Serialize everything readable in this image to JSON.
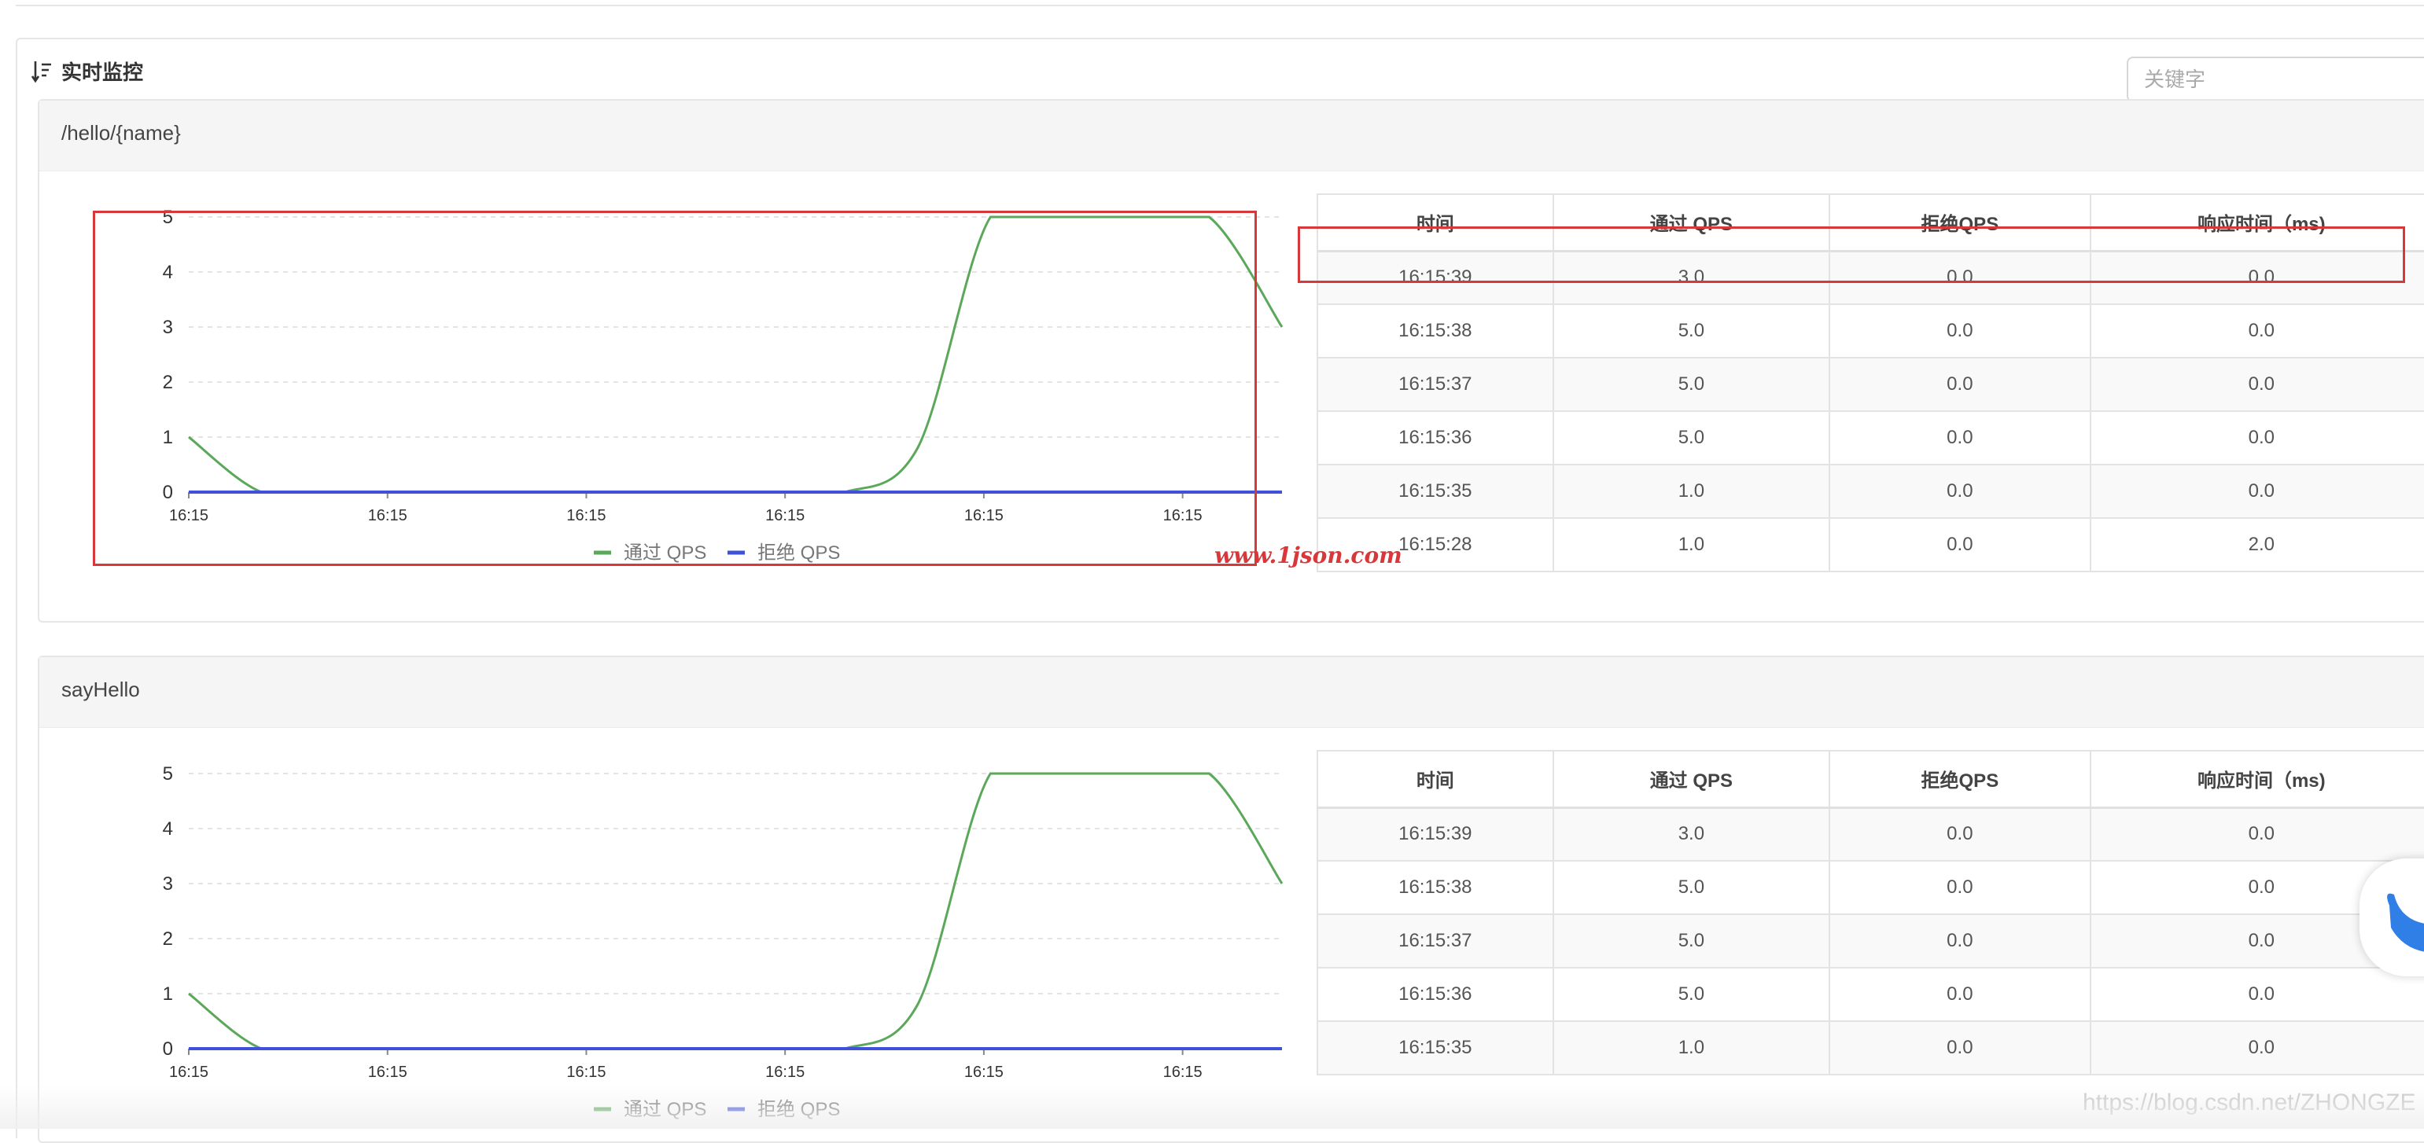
{
  "panel": {
    "title": "实时监控",
    "search_placeholder": "关键字"
  },
  "cards": [
    {
      "resource": "/hello/{name}",
      "chart_data": {
        "type": "line",
        "x": [
          "16:15",
          "16:15",
          "16:15",
          "16:15",
          "16:15",
          "16:15"
        ],
        "yticks": [
          0,
          1,
          2,
          3,
          4,
          5
        ],
        "ylim": [
          0,
          5
        ],
        "legend_position": "bottom-center",
        "series": [
          {
            "name": "通过 QPS",
            "color": "#5ba85a",
            "values": [
              1,
              0,
              0,
              0,
              0,
              0,
              0,
              0,
              0,
              0,
              0.8,
              5,
              5,
              5,
              5,
              3
            ]
          },
          {
            "name": "拒绝 QPS",
            "color": "#3f51d8",
            "values": [
              0,
              0,
              0,
              0,
              0,
              0,
              0,
              0,
              0,
              0,
              0,
              0,
              0,
              0,
              0,
              0
            ]
          }
        ]
      },
      "table": {
        "headers": [
          "时间",
          "通过 QPS",
          "拒绝QPS",
          "响应时间（ms)"
        ],
        "rows": [
          [
            "16:15:39",
            "3.0",
            "0.0",
            "0.0"
          ],
          [
            "16:15:38",
            "5.0",
            "0.0",
            "0.0"
          ],
          [
            "16:15:37",
            "5.0",
            "0.0",
            "0.0"
          ],
          [
            "16:15:36",
            "5.0",
            "0.0",
            "0.0"
          ],
          [
            "16:15:35",
            "1.0",
            "0.0",
            "0.0"
          ],
          [
            "16:15:28",
            "1.0",
            "0.0",
            "2.0"
          ]
        ]
      }
    },
    {
      "resource": "sayHello",
      "chart_data": {
        "type": "line",
        "x": [
          "16:15",
          "16:15",
          "16:15",
          "16:15",
          "16:15",
          "16:15"
        ],
        "yticks": [
          0,
          1,
          2,
          3,
          4,
          5
        ],
        "ylim": [
          0,
          5
        ],
        "series": [
          {
            "name": "通过 QPS",
            "color": "#5ba85a",
            "values": [
              1,
              0,
              0,
              0,
              0,
              0,
              0,
              0,
              0,
              0,
              0.8,
              5,
              5,
              5,
              5,
              3
            ]
          },
          {
            "name": "拒绝 QPS",
            "color": "#3f51d8",
            "values": [
              0,
              0,
              0,
              0,
              0,
              0,
              0,
              0,
              0,
              0,
              0,
              0,
              0,
              0,
              0,
              0
            ]
          }
        ]
      },
      "table": {
        "headers": [
          "时间",
          "通过 QPS",
          "拒绝QPS",
          "响应时间（ms)"
        ],
        "rows": [
          [
            "16:15:39",
            "3.0",
            "0.0",
            "0.0"
          ],
          [
            "16:15:38",
            "5.0",
            "0.0",
            "0.0"
          ],
          [
            "16:15:37",
            "5.0",
            "0.0",
            "0.0"
          ],
          [
            "16:15:36",
            "5.0",
            "0.0",
            "0.0"
          ],
          [
            "16:15:35",
            "1.0",
            "0.0",
            "0.0"
          ]
        ]
      }
    }
  ],
  "watermarks": {
    "site": "www.1json.com",
    "csdn": "https://blog.csdn.net/ZHONGZE"
  },
  "colors": {
    "highlight": "#d9383a",
    "pass": "#5ba85a",
    "block": "#3f51d8"
  }
}
